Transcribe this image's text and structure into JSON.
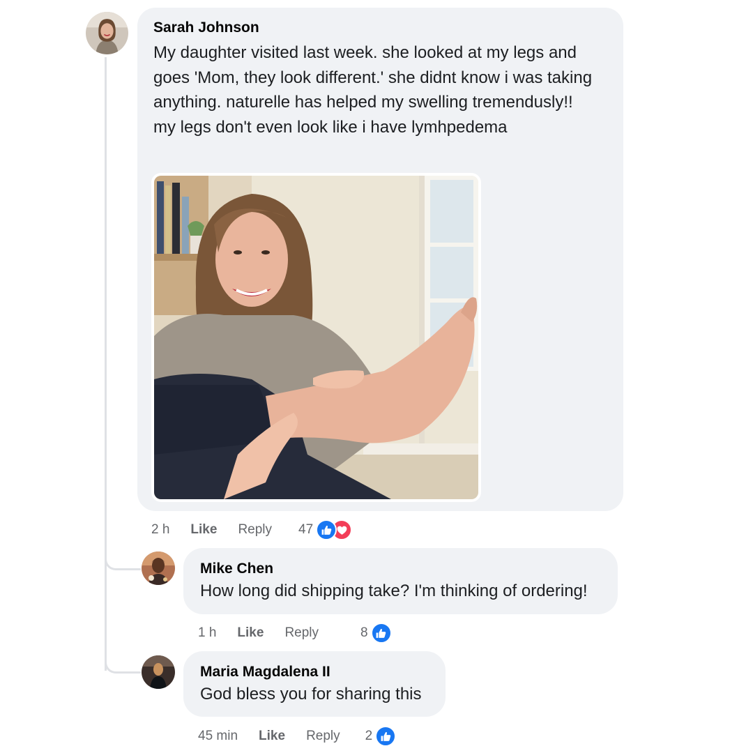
{
  "comments": [
    {
      "author": "Sarah Johnson",
      "text_lines": [
        "My daughter visited last week. she looked at my legs and",
        "goes 'Mom, they look different.' she didnt know i was taking",
        "anything. naturelle has helped my swelling tremendusly!!",
        "my legs don't even look like i have lymhpedema"
      ],
      "time": "2 h",
      "like_label": "Like",
      "reply_label": "Reply",
      "reaction_count": "47",
      "reactions": [
        "like-icon",
        "love-icon"
      ]
    }
  ],
  "replies": [
    {
      "author": "Mike Chen",
      "text": "How long did shipping take? I'm thinking of ordering!",
      "time": "1 h",
      "like_label": "Like",
      "reply_label": "Reply",
      "reaction_count": "8",
      "reactions": [
        "like-icon"
      ]
    },
    {
      "author": "Maria Magdalena II",
      "text": "God bless you for sharing this",
      "time": "45 min",
      "like_label": "Like",
      "reply_label": "Reply",
      "reaction_count": "2",
      "reactions": [
        "like-icon"
      ]
    }
  ],
  "colors": {
    "bubble": "#f0f2f5",
    "like_blue": "#1877f2",
    "love_red": "#f33e58",
    "meta_gray": "#65676b",
    "thread_line": "#dfe1e5"
  }
}
